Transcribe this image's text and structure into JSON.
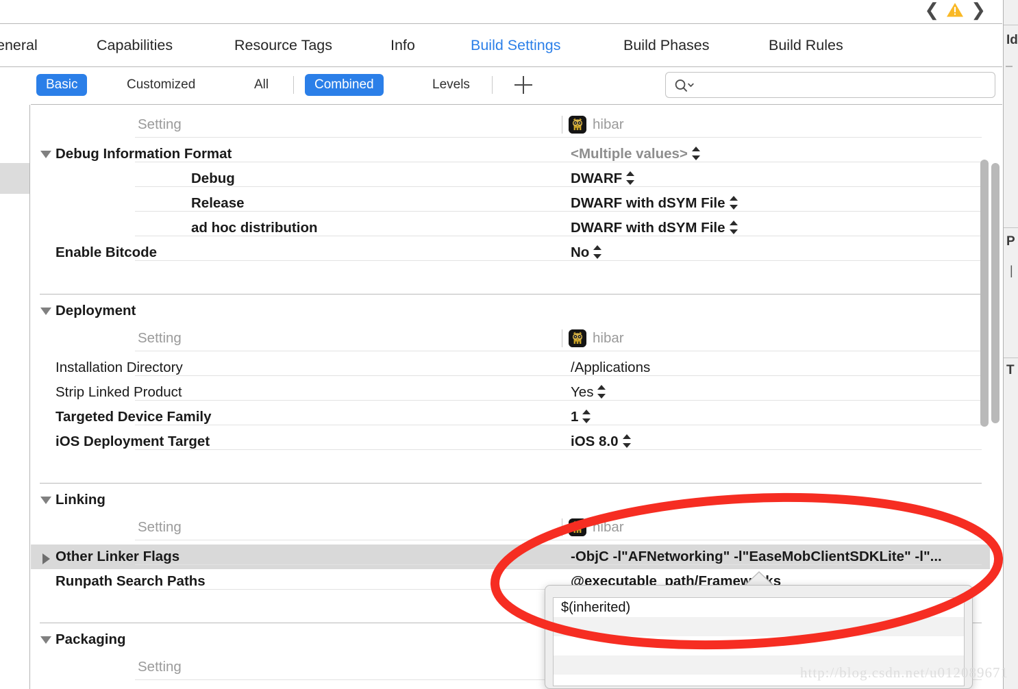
{
  "window": {
    "nav": {
      "back_icon": "chevron-left-icon",
      "forward_icon": "chevron-right-icon",
      "warning_icon": "warning-triangle-icon"
    }
  },
  "tabs": [
    {
      "label": "eneral",
      "active": false
    },
    {
      "label": "Capabilities",
      "active": false
    },
    {
      "label": "Resource Tags",
      "active": false
    },
    {
      "label": "Info",
      "active": false
    },
    {
      "label": "Build Settings",
      "active": true
    },
    {
      "label": "Build Phases",
      "active": false
    },
    {
      "label": "Build Rules",
      "active": false
    }
  ],
  "filterbar": {
    "scope": [
      {
        "label": "Basic",
        "selected": true
      },
      {
        "label": "Customized",
        "selected": false
      },
      {
        "label": "All",
        "selected": false
      }
    ],
    "mode": [
      {
        "label": "Combined",
        "selected": true
      },
      {
        "label": "Levels",
        "selected": false
      }
    ],
    "add_button_icon": "plus-icon",
    "search": {
      "icon": "search-icon",
      "chevron_icon": "chevron-down-icon",
      "value": "",
      "placeholder": ""
    }
  },
  "project": {
    "name": "hibar",
    "icon": "owl-app-icon"
  },
  "column_headers": {
    "setting": "Setting"
  },
  "sections": [
    {
      "id": "debug-information-format",
      "disclosure": "down",
      "header": "Debug Information Format",
      "header_value": "<Multiple values>",
      "header_value_has_stepper": true,
      "rows": [
        {
          "name": "Debug",
          "value": "DWARF",
          "bold": true,
          "stepper": true,
          "indent": "deep"
        },
        {
          "name": "Release",
          "value": "DWARF with dSYM File",
          "bold": true,
          "stepper": true,
          "indent": "deep"
        },
        {
          "name": "ad hoc distribution",
          "value": "DWARF with dSYM File",
          "bold": true,
          "stepper": true,
          "indent": "deep"
        },
        {
          "name": "Enable Bitcode",
          "value": "No",
          "bold": true,
          "stepper": true,
          "indent": "none"
        }
      ]
    },
    {
      "id": "deployment",
      "disclosure": "down",
      "header": "Deployment",
      "rows": [
        {
          "name": "Installation Directory",
          "value": "/Applications",
          "bold": false,
          "stepper": false,
          "indent": "none"
        },
        {
          "name": "Strip Linked Product",
          "value": "Yes",
          "bold": false,
          "stepper": true,
          "indent": "none"
        },
        {
          "name": "Targeted Device Family",
          "value": "1",
          "bold": true,
          "stepper": true,
          "indent": "none"
        },
        {
          "name": "iOS Deployment Target",
          "value": "iOS 8.0",
          "bold": true,
          "stepper": true,
          "indent": "none"
        }
      ]
    },
    {
      "id": "linking",
      "disclosure": "down",
      "header": "Linking",
      "rows": [
        {
          "name": "Other Linker Flags",
          "value": "-ObjC -l\"AFNetworking\" -l\"EaseMobClientSDKLite\" -l\"...",
          "bold": true,
          "stepper": false,
          "indent": "none",
          "selected": true,
          "disclosure": "right"
        },
        {
          "name": "Runpath Search Paths",
          "value": "@executable_path/Frameworks",
          "bold": true,
          "stepper": false,
          "indent": "none"
        }
      ]
    },
    {
      "id": "packaging",
      "disclosure": "down",
      "header": "Packaging",
      "rows": []
    }
  ],
  "popover": {
    "arrow_icon": "popover-arrow-icon",
    "entries": [
      {
        "text": "$(inherited)"
      },
      {
        "text": ""
      },
      {
        "text": ""
      },
      {
        "text": ""
      }
    ]
  },
  "inspector": {
    "sections": [
      {
        "label": "Id"
      },
      {
        "label": "P"
      },
      {
        "label": "T"
      }
    ]
  },
  "annotation": {
    "shape": "red-ellipse-highlight",
    "color": "#f62d22"
  },
  "watermark": {
    "text": "http://blog.csdn.net/u012089671"
  }
}
